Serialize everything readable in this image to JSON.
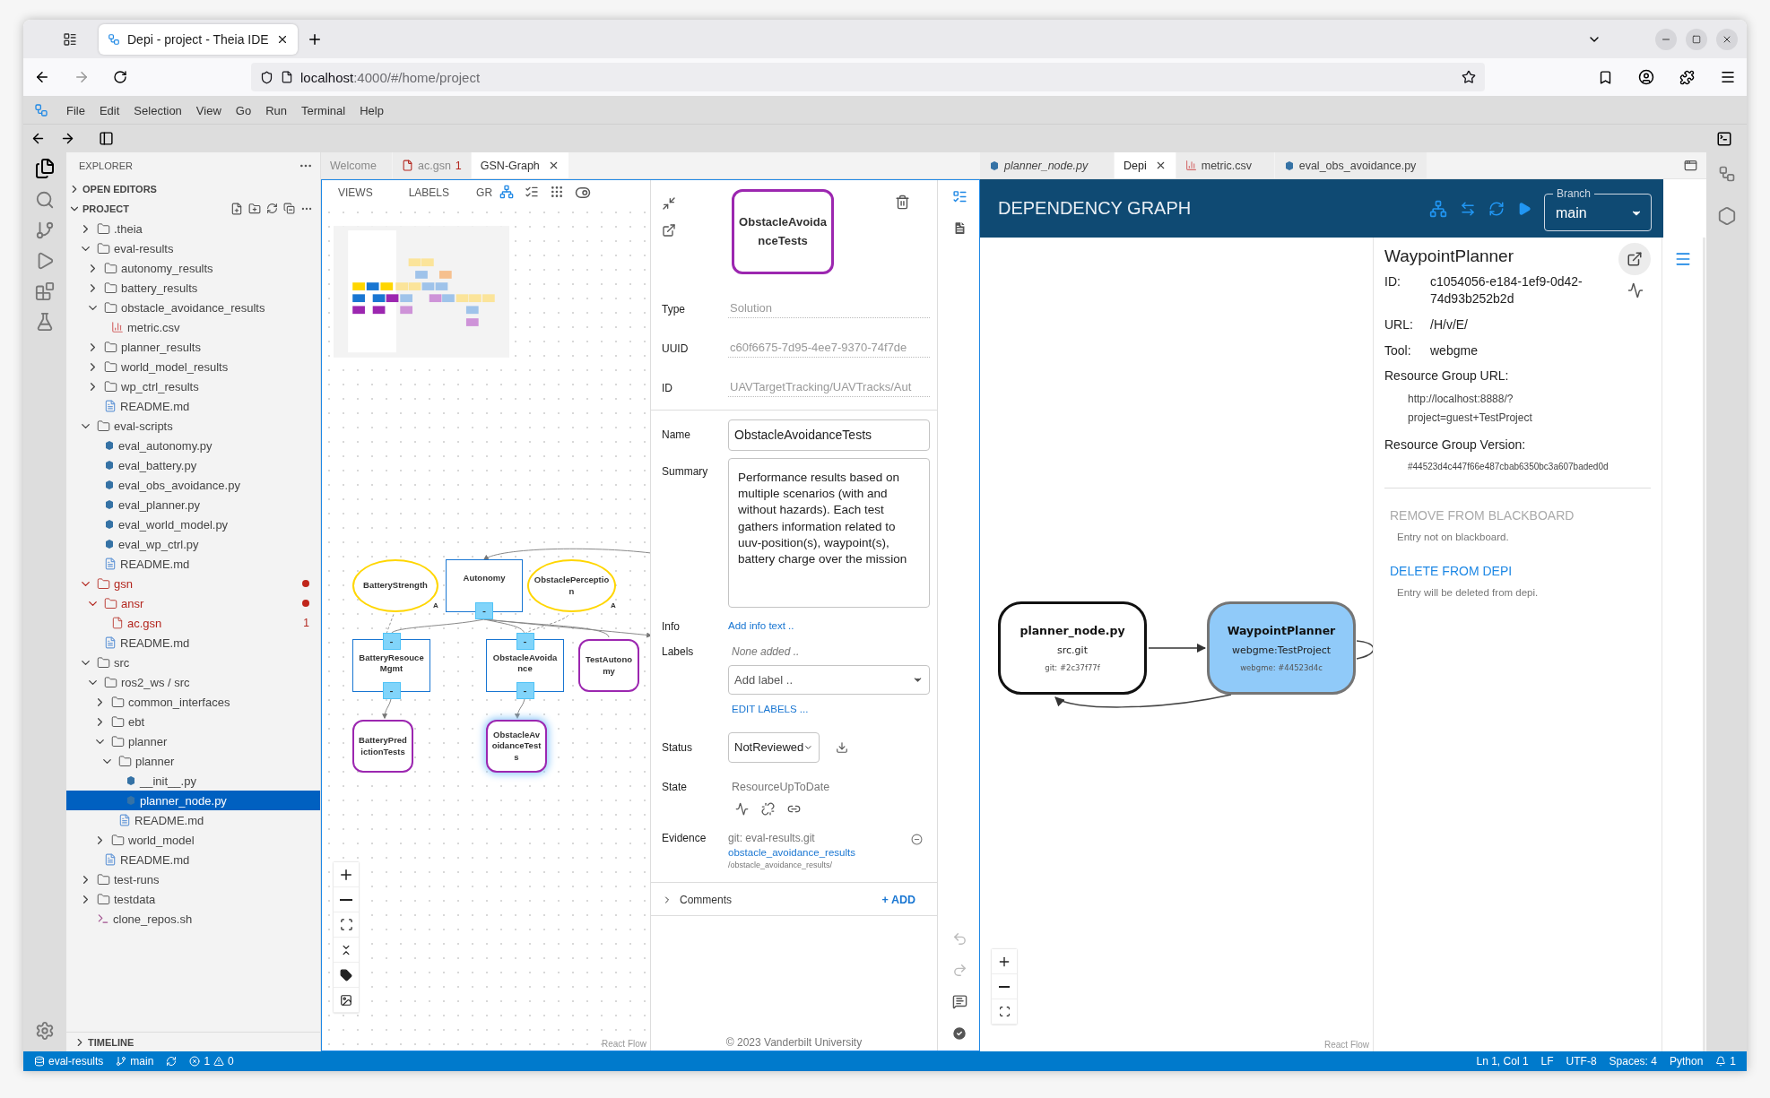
{
  "browser": {
    "tab_title": "Depi - project - Theia IDE",
    "url_host": "localhost",
    "url_path": ":4000/#/home/project"
  },
  "menu": [
    "File",
    "Edit",
    "Selection",
    "View",
    "Go",
    "Run",
    "Terminal",
    "Help"
  ],
  "explorer": {
    "title": "EXPLORER",
    "sections": [
      {
        "label": "OPEN EDITORS",
        "expanded": false
      },
      {
        "label": "PROJECT",
        "expanded": true
      }
    ],
    "timeline": {
      "label": "TIMELINE",
      "expanded": false
    },
    "tree": [
      {
        "name": ".theia",
        "kind": "folder",
        "expanded": false,
        "selected": false
      },
      {
        "name": "eval-results",
        "kind": "folder",
        "expanded": true,
        "selected": false,
        "children": [
          {
            "name": "autonomy_results",
            "kind": "folder",
            "expanded": false,
            "selected": false
          },
          {
            "name": "battery_results",
            "kind": "folder",
            "expanded": false,
            "selected": false
          },
          {
            "name": "obstacle_avoidance_results",
            "kind": "folder",
            "expanded": true,
            "selected": false,
            "children": [
              {
                "name": "metric.csv",
                "kind": "csv",
                "selected": false
              }
            ]
          },
          {
            "name": "planner_results",
            "kind": "folder",
            "expanded": false,
            "selected": false
          },
          {
            "name": "world_model_results",
            "kind": "folder",
            "expanded": false,
            "selected": false
          },
          {
            "name": "wp_ctrl_results",
            "kind": "folder",
            "expanded": false,
            "selected": false
          },
          {
            "name": "README.md",
            "kind": "markdown",
            "selected": false
          }
        ]
      },
      {
        "name": "eval-scripts",
        "kind": "folder",
        "expanded": true,
        "selected": false,
        "children": [
          {
            "name": "eval_autonomy.py",
            "kind": "python",
            "selected": false
          },
          {
            "name": "eval_battery.py",
            "kind": "python",
            "selected": false
          },
          {
            "name": "eval_obs_avoidance.py",
            "kind": "python",
            "selected": false
          },
          {
            "name": "eval_planner.py",
            "kind": "python",
            "selected": false
          },
          {
            "name": "eval_world_model.py",
            "kind": "python",
            "selected": false
          },
          {
            "name": "eval_wp_ctrl.py",
            "kind": "python",
            "selected": false
          },
          {
            "name": "README.md",
            "kind": "markdown",
            "selected": false
          }
        ]
      },
      {
        "name": "gsn",
        "kind": "folder",
        "expanded": true,
        "selected": false,
        "error": true,
        "dot": true,
        "children": [
          {
            "name": "ansr",
            "kind": "folder",
            "expanded": true,
            "selected": false,
            "error": true,
            "dot": true,
            "children": [
              {
                "name": "ac.gsn",
                "kind": "file",
                "selected": false,
                "error": true,
                "badge": "1"
              }
            ]
          },
          {
            "name": "README.md",
            "kind": "markdown",
            "selected": false
          }
        ]
      },
      {
        "name": "src",
        "kind": "folder",
        "expanded": true,
        "selected": false,
        "children": [
          {
            "name": "ros2_ws / src",
            "kind": "folder",
            "expanded": true,
            "selected": false,
            "children": [
              {
                "name": "common_interfaces",
                "kind": "folder",
                "expanded": false,
                "selected": false
              },
              {
                "name": "ebt",
                "kind": "folder",
                "expanded": false,
                "selected": false
              },
              {
                "name": "planner",
                "kind": "folder",
                "expanded": true,
                "selected": false,
                "children": [
                  {
                    "name": "planner",
                    "kind": "folder",
                    "expanded": true,
                    "selected": false,
                    "children": [
                      {
                        "name": "__init__.py",
                        "kind": "python",
                        "selected": false
                      },
                      {
                        "name": "planner_node.py",
                        "kind": "python",
                        "selected": true
                      }
                    ]
                  },
                  {
                    "name": "README.md",
                    "kind": "markdown",
                    "selected": false
                  }
                ]
              },
              {
                "name": "world_model",
                "kind": "folder",
                "expanded": false,
                "selected": false
              }
            ]
          },
          {
            "name": "README.md",
            "kind": "markdown",
            "selected": false
          }
        ]
      },
      {
        "name": "test-runs",
        "kind": "folder",
        "expanded": false,
        "selected": false
      },
      {
        "name": "testdata",
        "kind": "folder",
        "expanded": false,
        "selected": false
      },
      {
        "name": "clone_repos.sh",
        "kind": "shell",
        "selected": false
      }
    ]
  },
  "left_tabs": [
    {
      "label": "Welcome",
      "kind": "welcome",
      "selected": false
    },
    {
      "label": "ac.gsn",
      "kind": "gsn",
      "badge": "1",
      "selected": false
    },
    {
      "label": "GSN-Graph",
      "kind": "graph",
      "selected": true
    }
  ],
  "gsn": {
    "toolbar": [
      "VIEWS",
      "LABELS",
      "GR"
    ],
    "nodes": [
      {
        "label": "BatteryStrength",
        "kind": "goal",
        "selected": false,
        "annotation": "A"
      },
      {
        "label": "Autonomy",
        "kind": "strategy",
        "selected": false,
        "bottom_handle": "-"
      },
      {
        "label": "ObstaclePerception",
        "kind": "goal",
        "selected": false,
        "annotation": "A"
      },
      {
        "label": "BatteryResouceMgmt",
        "kind": "strategy",
        "selected": false,
        "top_handle": "-",
        "bottom_handle": "-"
      },
      {
        "label": "ObstacleAvoidance",
        "kind": "strategy",
        "selected": false,
        "top_handle": "-",
        "bottom_handle": "-"
      },
      {
        "label": "TestAutonomy",
        "kind": "solution",
        "selected": false
      },
      {
        "label": "BatteryPredictionTests",
        "kind": "solution",
        "selected": false
      },
      {
        "label": "ObstacleAvoidanceTests",
        "kind": "solution",
        "selected": true
      }
    ],
    "watermark": "React Flow"
  },
  "properties": {
    "node_label": "ObstacleAvoidanceTests",
    "fields": [
      {
        "label": "Type",
        "value": "Solution"
      },
      {
        "label": "UUID",
        "value": "c60f6675-7d95-4ee7-9370-74f7de"
      },
      {
        "label": "ID",
        "value": "UAVTargetTracking/UAVTracks/Aut"
      }
    ],
    "name": {
      "label": "Name",
      "value": "ObstacleAvoidanceTests"
    },
    "summary": {
      "label": "Summary",
      "value": "Performance results based on multiple scenarios (with and without hazards). Each test gathers information related to uuv-position(s), waypoint(s), battery charge over the mission"
    },
    "info": {
      "label": "Info",
      "link": "Add info text .."
    },
    "labels": {
      "label": "Labels",
      "empty": "None added ..",
      "placeholder": "Add label ..",
      "edit": "EDIT LABELS ..."
    },
    "status": {
      "label": "Status",
      "value": "NotReviewed"
    },
    "state": {
      "label": "State",
      "value": "ResourceUpToDate"
    },
    "evidence": {
      "label": "Evidence",
      "repo": "git: eval-results.git",
      "link": "obstacle_avoidance_results",
      "path": "/obstacle_avoidance_results/"
    },
    "comments": {
      "label": "Comments",
      "expanded": false,
      "add": "+ ADD"
    },
    "footer": "© 2023 Vanderbilt University"
  },
  "right_tabs": [
    {
      "label": "planner_node.py",
      "kind": "python",
      "preview": true,
      "selected": false
    },
    {
      "label": "Depi",
      "kind": "depi",
      "preview": false,
      "selected": true
    },
    {
      "label": "metric.csv",
      "kind": "csv",
      "preview": false,
      "selected": false
    },
    {
      "label": "eval_obs_avoidance.py",
      "kind": "python",
      "preview": false,
      "selected": false
    }
  ],
  "depi": {
    "title": "DEPENDENCY GRAPH",
    "branch_legend": "Branch",
    "branch": "main",
    "nodes": [
      {
        "title": "planner_node.py",
        "subtitle": "src.git",
        "version": "git: #2c37f77f",
        "selected": false
      },
      {
        "title": "WaypointPlanner",
        "subtitle": "webgme:TestProject",
        "version": "webgme: #44523d4c",
        "selected": true
      }
    ],
    "watermark": "React Flow",
    "detail": {
      "title": "WaypointPlanner",
      "rows": [
        {
          "label": "ID:",
          "value": "c1054056-e184-1ef9-0d42-74d93b252b2d"
        },
        {
          "label": "URL:",
          "value": "/H/v/E/"
        },
        {
          "label": "Tool:",
          "value": "webgme"
        }
      ],
      "group_url": {
        "label": "Resource Group URL:",
        "value": "http://localhost:8888/?project=guest+TestProject"
      },
      "group_version": {
        "label": "Resource Group Version:",
        "value": "#44523d4c447f66e487cbab6350bc3a607baded0d"
      },
      "actions": [
        {
          "label": "REMOVE FROM BLACKBOARD",
          "disabled": true,
          "note": "Entry not on blackboard."
        },
        {
          "label": "DELETE FROM DEPI",
          "disabled": false,
          "note": "Entry will be deleted from depi."
        }
      ]
    }
  },
  "status_bar": {
    "repo": "eval-results",
    "branch": "main",
    "errors": "1",
    "warnings": "0",
    "right": [
      "Ln 1, Col 1",
      "LF",
      "UTF-8",
      "Spaces: 4",
      "Python"
    ],
    "notifications": "1"
  }
}
